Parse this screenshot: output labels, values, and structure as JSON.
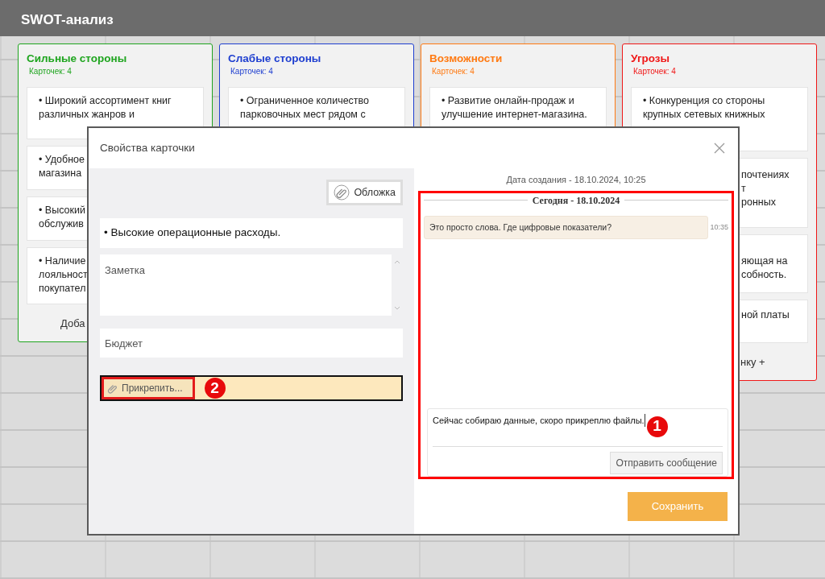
{
  "app": {
    "title": "SWOT-анализ"
  },
  "columns": [
    {
      "title": "Сильные стороны",
      "color": "#1fa51f",
      "count": "Карточек: 4",
      "cards": [
        {
          "text": "• Широкий ассортимент книг\nразличных жанров и"
        },
        {
          "text": "• Удобное\nмагазина"
        },
        {
          "text": "• Высокий\nобслужив"
        },
        {
          "text": "• Наличие\nлояльност\nпокупател"
        }
      ],
      "add_label": "Доба"
    },
    {
      "title": "Слабые стороны",
      "color": "#1f3fd0",
      "count": "Карточек: 4",
      "cards": [
        {
          "text": "• Ограниченное количество\nпарковочных мест рядом с"
        }
      ]
    },
    {
      "title": "Возможности",
      "color": "#ff7a12",
      "count": "Карточек: 4",
      "cards": [
        {
          "text": "• Развитие онлайн-продаж и\nулучшение интернет-магазина."
        }
      ]
    },
    {
      "title": "Угрозы",
      "color": "#f01818",
      "count": "Карточек: 4",
      "cards": [
        {
          "text": "• Конкуренция со стороны\nкрупных сетевых книжных"
        },
        {
          "text": "почтениях\nт\nронных"
        },
        {
          "text": "яющая на\nсобность."
        },
        {
          "text": "ной платы"
        }
      ],
      "add_label": "нку +"
    }
  ],
  "dialog": {
    "title": "Свойства карточки",
    "cover_button": "Обложка",
    "card_title": "• Высокие операционные расходы.",
    "note_placeholder": "Заметка",
    "budget_placeholder": "Бюджет",
    "attach_button": "Прикрепить...",
    "created": "Дата создания - 18.10.2024, 10:25",
    "chat": {
      "day": "Сегодня - 18.10.2024",
      "messages": [
        {
          "text": "Это просто слова. Где цифровые показатели?",
          "time": "10:35"
        }
      ],
      "draft": "Сейчас собираю данные, скоро прикреплю файлы.",
      "send_button": "Отправить сообщение"
    },
    "save_button": "Сохранить"
  },
  "annotations": [
    {
      "label": "1"
    },
    {
      "label": "2"
    }
  ]
}
